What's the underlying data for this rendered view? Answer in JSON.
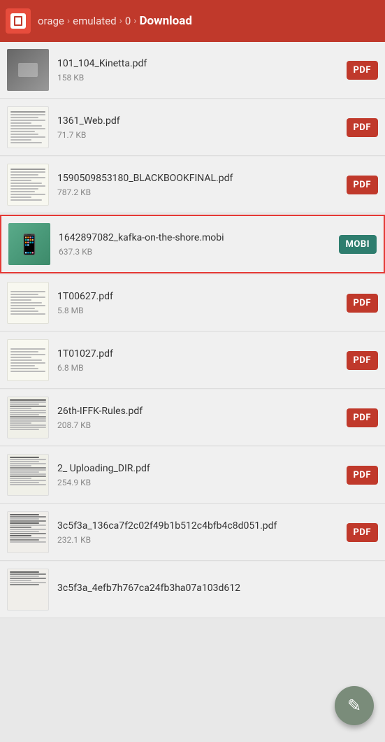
{
  "header": {
    "logo_label": "SD",
    "breadcrumbs": [
      {
        "label": "orage",
        "active": false
      },
      {
        "label": "emulated",
        "active": false
      },
      {
        "label": "0",
        "active": false
      },
      {
        "label": "Download",
        "active": true
      }
    ]
  },
  "files": [
    {
      "id": "kinetta",
      "name": "101_104_Kinetta.pdf",
      "size": "158 KB",
      "badge": "PDF",
      "badge_type": "pdf",
      "thumb_type": "photo",
      "highlighted": false
    },
    {
      "id": "web",
      "name": "1361_Web.pdf",
      "size": "71.7 KB",
      "badge": "PDF",
      "badge_type": "pdf",
      "thumb_type": "lines",
      "highlighted": false
    },
    {
      "id": "blackbook",
      "name": "1590509853180_BLACKBOOKFINAL.pdf",
      "size": "787.2 KB",
      "badge": "PDF",
      "badge_type": "pdf",
      "thumb_type": "lines",
      "highlighted": false
    },
    {
      "id": "kafka",
      "name": "1642897082_kafka-on-the-shore.mobi",
      "size": "637.3 KB",
      "badge": "MOBI",
      "badge_type": "mobi",
      "thumb_type": "mobi",
      "highlighted": true
    },
    {
      "id": "1T00627",
      "name": "1T00627.pdf",
      "size": "5.8 MB",
      "badge": "PDF",
      "badge_type": "pdf",
      "thumb_type": "blank",
      "highlighted": false
    },
    {
      "id": "1T01027",
      "name": "1T01027.pdf",
      "size": "6.8 MB",
      "badge": "PDF",
      "badge_type": "pdf",
      "thumb_type": "blank",
      "highlighted": false
    },
    {
      "id": "26th",
      "name": "26th-IFFK-Rules.pdf",
      "size": "208.7 KB",
      "badge": "PDF",
      "badge_type": "pdf",
      "thumb_type": "small_text",
      "highlighted": false
    },
    {
      "id": "upload",
      "name": "2_ Uploading_DIR.pdf",
      "size": "254.9 KB",
      "badge": "PDF",
      "badge_type": "pdf",
      "thumb_type": "small_text",
      "highlighted": false
    },
    {
      "id": "3c5f3a",
      "name": "3c5f3a_136ca7f2c02f49b1b512c4bfb4c8d051.pdf",
      "size": "232.1 KB",
      "badge": "PDF",
      "badge_type": "pdf",
      "thumb_type": "small_text_dark",
      "highlighted": false
    },
    {
      "id": "3c5f3a_4efb",
      "name": "3c5f3a_4efb7h767ca24fb3ha07a103d612",
      "size": "",
      "badge": "",
      "badge_type": "",
      "thumb_type": "blank",
      "highlighted": false
    }
  ],
  "fab": {
    "icon": "✎",
    "label": "edit"
  }
}
